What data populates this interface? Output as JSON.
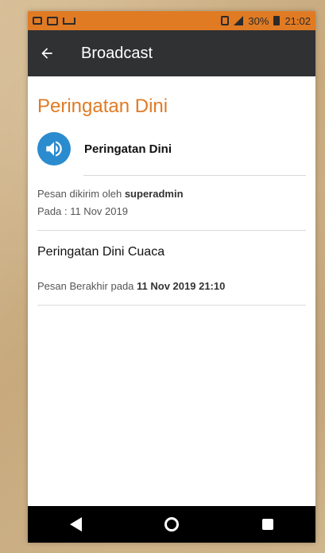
{
  "status_bar": {
    "battery_percent": "30%",
    "time": "21:02"
  },
  "app_bar": {
    "title": "Broadcast"
  },
  "page": {
    "title": "Peringatan Dini"
  },
  "sender": {
    "name": "Peringatan Dini"
  },
  "meta": {
    "sent_by_prefix": "Pesan dikirim oleh ",
    "sent_by_user": "superadmin",
    "date_label": "Pada : 11 Nov 2019"
  },
  "message": {
    "text": "Peringatan Dini Cuaca"
  },
  "expiry": {
    "prefix": "Pesan Berakhir pada ",
    "datetime": "11 Nov 2019 21:10"
  },
  "colors": {
    "accent": "#e07b24",
    "appbar": "#2f3133",
    "icon_blue": "#2a8ccf"
  },
  "icons": {
    "back": "arrow-left-icon",
    "speaker": "speaker-icon",
    "nav_back": "nav-back-icon",
    "nav_home": "nav-home-icon",
    "nav_recents": "nav-recents-icon"
  }
}
